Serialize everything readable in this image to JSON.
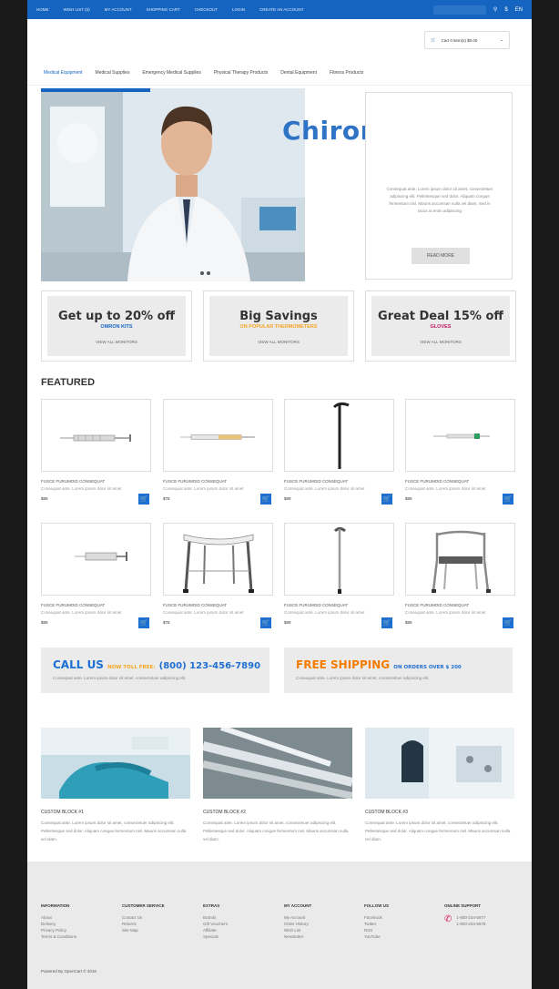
{
  "topbar": {
    "links": [
      "HOME",
      "WISH LIST (0)",
      "MY ACCOUNT",
      "SHOPPING CART",
      "CHECKOUT",
      "LOGIN",
      "CREATE AN ACCOUNT"
    ],
    "currency": "$",
    "language": "EN"
  },
  "cart": {
    "label": "Cart 0 item(s) $0.00"
  },
  "menu": [
    "Medical Equipment",
    "Medical Supplies",
    "Emergency Medical Supplies",
    "Physical Therapy Products",
    "Dental Equipment",
    "Fitness Products"
  ],
  "watermark": "Chiroro.vn",
  "hero": {
    "text": "Consequat ante. Lorem ipsum dolor sit amet, consectetuer adipiscing elit. Pellentesque sed dolor. Aliquam congue fermentum nisl. Mauris accumsan nulla vel diam. Sed in lacus ut enim adipiscing",
    "read_more": "READ MORE"
  },
  "promos": [
    {
      "title": "Get up to 20% off",
      "subtitle": "OMRON KITS",
      "subtitle_color": "#1565c0",
      "link": "VIEW ALL MONITORS"
    },
    {
      "title": "Big Savings",
      "subtitle": "ON POPULAR THERMOMETERS",
      "subtitle_color": "#f5a623",
      "link": "VIEW ALL MONITORS"
    },
    {
      "title": "Great Deal 15% off",
      "subtitle": "GLOVES",
      "subtitle_color": "#c2185b",
      "link": "VIEW ALL MONITORS"
    }
  ],
  "featured_title": "FEATURED",
  "products": [
    {
      "icon": "syringe-icon",
      "name": "FUSCE FURUMOID CONSEQUAT",
      "desc": "Consequat ante. Lorem ipsum dolor sit amet",
      "price": "$89"
    },
    {
      "icon": "syringe-icon",
      "name": "FUSCE FURUMOID CONSEQUAT",
      "desc": "Consequat ante. Lorem ipsum dolor sit amet",
      "price": "$78"
    },
    {
      "icon": "cane-icon",
      "name": "FUSCE FURUMOID CONSEQUAT",
      "desc": "Consequat ante. Lorem ipsum dolor sit amet",
      "price": "$89"
    },
    {
      "icon": "syringe-icon",
      "name": "FUSCE FURUMOID CONSEQUAT",
      "desc": "Consequat ante. Lorem ipsum dolor sit amet",
      "price": "$89"
    },
    {
      "icon": "syringe-icon",
      "name": "FUSCE FURUMOID CONSEQUAT",
      "desc": "Consequat ante. Lorem ipsum dolor sit amet",
      "price": "$89"
    },
    {
      "icon": "shower-stool-icon",
      "name": "FUSCE FURUMOID CONSEQUAT",
      "desc": "Consequat ante. Lorem ipsum dolor sit amet",
      "price": "$78"
    },
    {
      "icon": "cane-icon",
      "name": "FUSCE FURUMOID CONSEQUAT",
      "desc": "Consequat ante. Lorem ipsum dolor sit amet",
      "price": "$89"
    },
    {
      "icon": "commode-chair-icon",
      "name": "FUSCE FURUMOID CONSEQUAT",
      "desc": "Consequat ante. Lorem ipsum dolor sit amet",
      "price": "$89"
    }
  ],
  "banners": [
    {
      "title": "CALL US",
      "title_color": "#1e6fd2",
      "mid": "NOW TOLL FREE:",
      "mid_color": "#f5a623",
      "tail": "(800) 123-456-7890",
      "tail_color": "#1e6fd2",
      "desc": "Consequat ante. Lorem ipsum dolor sit amet, consectetuer adipiscing elit."
    },
    {
      "title": "FREE SHIPPING",
      "title_color": "#f57c00",
      "mid": "ON ORDERS OVER $ 200",
      "mid_color": "#1e6fd2",
      "tail": "",
      "tail_color": "#1e6fd2",
      "desc": "Consequat ante. Lorem ipsum dolor sit amet, consectetuer adipiscing elit."
    }
  ],
  "blocks": [
    {
      "title": "CUSTOM BLOCK #1",
      "desc": "Consequat ante. Lorem ipsum dolor sit amet, consectetuer adipiscing elit. Pellentesque sed dolor. Aliquam congue fermentum nisl. Mauris accumsan nulla vel diam."
    },
    {
      "title": "CUSTOM BLOCK #2",
      "desc": "Consequat ante. Lorem ipsum dolor sit amet, consectetuer adipiscing elit. Pellentesque sed dolor. Aliquam congue fermentum nisl. Mauris accumsan nulla vel diam."
    },
    {
      "title": "CUSTOM BLOCK #3",
      "desc": "Consequat ante. Lorem ipsum dolor sit amet, consectetuer adipiscing elit. Pellentesque sed dolor. Aliquam congue fermentum nisl. Mauris accumsan nulla vel diam."
    }
  ],
  "footer": {
    "columns": [
      {
        "heading": "INFORMATION",
        "links": [
          "About",
          "Delivery",
          "Privacy Policy",
          "Terms & Conditions"
        ]
      },
      {
        "heading": "CUSTOMER SERVICE",
        "links": [
          "Contact Us",
          "Returns",
          "Site Map"
        ]
      },
      {
        "heading": "EXTRAS",
        "links": [
          "Brands",
          "Gift Vouchers",
          "Affiliate",
          "Specials"
        ]
      },
      {
        "heading": "MY ACCOUNT",
        "links": [
          "My Account",
          "Order History",
          "Wish List",
          "Newsletter"
        ]
      },
      {
        "heading": "FOLLOW US",
        "links": [
          "Facebook",
          "Twitter",
          "RSS",
          "YouTube"
        ]
      },
      {
        "heading": "ONLINE SUPPORT",
        "links": [
          "1-800-234-5677",
          "1-800-234-5678"
        ]
      }
    ],
    "powered": "Powered By OpenCart © 2016"
  }
}
